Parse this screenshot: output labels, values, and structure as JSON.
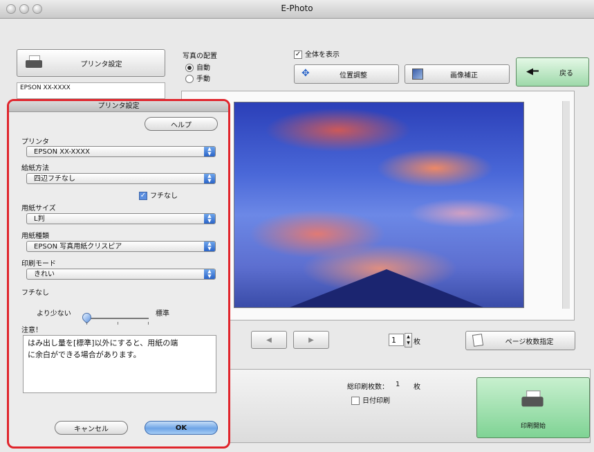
{
  "window": {
    "title": "E-Photo"
  },
  "left_panel": {
    "printer_settings_button": "プリンタ設定",
    "printer_status_line1": "EPSON XX-XXXX"
  },
  "layout_section": {
    "label": "写真の配置",
    "option_auto": "自動",
    "option_manual": "手動",
    "selected": "自動"
  },
  "show_all": {
    "label": "全体を表示",
    "checked": true
  },
  "toolbar": {
    "position_adjust": "位置調整",
    "image_correct": "画像補正",
    "back": "戻る"
  },
  "nav": {
    "prev_icon": "left-arrow-icon",
    "next_icon": "right-arrow-icon",
    "copies_value": "1",
    "copies_unit": "枚",
    "page_count_button": "ページ枚数指定"
  },
  "bottom": {
    "total_label": "総印刷枚数：",
    "total_value": "1",
    "total_unit": "枚",
    "date_print_label": "日付印刷",
    "date_print_checked": false,
    "start_print": "印刷開始"
  },
  "sheet": {
    "title": "プリンタ設定",
    "help_button": "ヘルプ",
    "printer_label": "プリンタ",
    "printer_value": "EPSON XX-XXXX",
    "feed_label": "給紙方法",
    "feed_value": "四辺フチなし",
    "borderless_check_label": "フチなし",
    "borderless_checked": true,
    "paper_size_label": "用紙サイズ",
    "paper_size_value": "L判",
    "paper_type_label": "用紙種類",
    "paper_type_value": "EPSON 写真用紙クリスピア",
    "print_mode_label": "印刷モード",
    "print_mode_value": "きれい",
    "expansion_label": "フチなし",
    "slider_min_label": "より少ない",
    "slider_max_label": "標準",
    "slider_level": 0,
    "note_label": "注意！",
    "note_text_line1": "はみ出し量を[標準]以外にすると、用紙の端",
    "note_text_line2": "に余白ができる場合があります。",
    "cancel_button": "キャンセル",
    "ok_button": "OK"
  },
  "colors": {
    "accent_blue": "#2a64c8",
    "highlight_red": "#e0242b",
    "print_green": "#7fd394"
  }
}
